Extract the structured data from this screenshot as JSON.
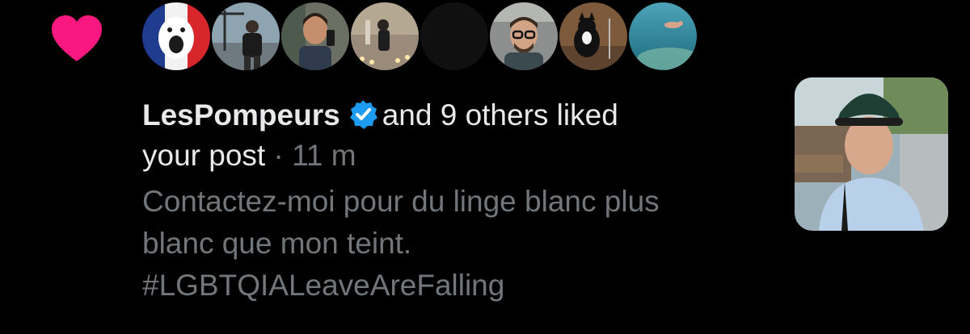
{
  "notification": {
    "type": "like",
    "icon": "heart-icon",
    "icon_color": "#f91880",
    "actor": "LesPompeurs",
    "actor_verified": true,
    "verified_icon": "verified-badge-icon",
    "verified_color": "#1d9bf0",
    "summary_text": "and 9 others liked",
    "summary_text_2": "your post",
    "separator": "·",
    "time_ago": "11 m",
    "post_text_line1": "Contactez-moi pour du linge blanc plus",
    "post_text_line2": "blanc que mon teint.",
    "post_hashtag": "#LGBTQIALeaveAreFalling",
    "liker_avatars": [
      "avatar-french-flag-mascot",
      "avatar-man-with-crane",
      "avatar-man-selfie",
      "avatar-person-candles",
      "avatar-dark",
      "avatar-man-glasses",
      "avatar-cat",
      "avatar-underwater"
    ],
    "post_thumbnail": "post-thumbnail-selfie"
  },
  "colors": {
    "background": "#000000",
    "primary_text": "#e7e9ea",
    "secondary_text": "#71767b"
  }
}
